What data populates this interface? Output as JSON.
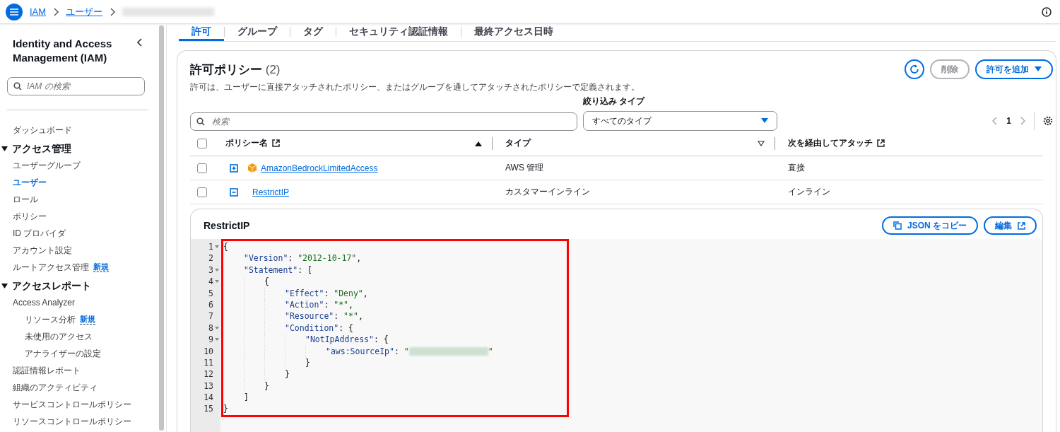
{
  "breadcrumbs": [
    {
      "label": "IAM",
      "kind": "link"
    },
    {
      "label": "ユーザー",
      "kind": "link"
    },
    {
      "kind": "redacted"
    }
  ],
  "sidebar": {
    "title": "Identity and Access Management (IAM)",
    "search": {
      "placeholder": "IAM の検索"
    },
    "items": [
      {
        "label": "ダッシュボード",
        "kind": "link",
        "selected": false
      },
      {
        "label": "アクセス管理",
        "kind": "section",
        "expanded": true,
        "children": [
          {
            "label": "ユーザーグループ",
            "selected": false
          },
          {
            "label": "ユーザー",
            "selected": true
          },
          {
            "label": "ロール",
            "selected": false
          },
          {
            "label": "ポリシー",
            "selected": false
          },
          {
            "label": "ID プロバイダ",
            "selected": false
          },
          {
            "label": "アカウント設定",
            "selected": false
          },
          {
            "label": "ルートアクセス管理",
            "selected": false,
            "badge": "新規"
          }
        ]
      },
      {
        "label": "アクセスレポート",
        "kind": "section",
        "expanded": true,
        "children": [
          {
            "label": "Access Analyzer",
            "selected": false,
            "children": [
              {
                "label": "リソース分析",
                "selected": false,
                "badge": "新規"
              },
              {
                "label": "未使用のアクセス",
                "selected": false
              },
              {
                "label": "アナライザーの設定",
                "selected": false
              }
            ]
          },
          {
            "label": "認証情報レポート",
            "selected": false
          },
          {
            "label": "組織のアクティビティ",
            "selected": false
          },
          {
            "label": "サービスコントロールポリシー",
            "selected": false
          },
          {
            "label": "リソースコントロールポリシー",
            "selected": false
          }
        ]
      }
    ]
  },
  "tabs": [
    {
      "label": "許可",
      "selected": true
    },
    {
      "label": "グループ",
      "selected": false
    },
    {
      "label": "タグ",
      "selected": false
    },
    {
      "label": "セキュリティ認証情報",
      "selected": false
    },
    {
      "label": "最終アクセス日時",
      "selected": false
    }
  ],
  "policies": {
    "title": "許可ポリシー",
    "count": "(2)",
    "description": "許可は、ユーザーに直接アタッチされたポリシー、またはグループを通してアタッチされたポリシーで定義されます。",
    "buttons": [
      {
        "label": "削除",
        "disabled": true
      },
      {
        "label": "許可を追加",
        "disabled": false
      }
    ],
    "search": {
      "placeholder": "検索"
    },
    "filter": {
      "label": "絞り込み タイプ",
      "value": "すべてのタイプ"
    },
    "page": "1",
    "select_all": {
      "checked": false
    },
    "columns": [
      {
        "label": "ポリシー名",
        "sortable": true,
        "sorted": true,
        "external": true
      },
      {
        "label": "タイプ",
        "sortable": true,
        "sorted": false,
        "external": false
      },
      {
        "label": "次を経由してアタッチ",
        "sortable": false,
        "external": true
      }
    ],
    "rows": [
      {
        "name": "AmazonBedrockLimitedAccess",
        "managed": true,
        "expanded": false,
        "checked": false,
        "type": "AWS 管理",
        "attached": "直接"
      },
      {
        "name": "RestrictIP",
        "managed": false,
        "expanded": true,
        "checked": false,
        "type": "カスタマーインライン",
        "attached": "インライン"
      }
    ]
  },
  "detail": {
    "title": "RestrictIP",
    "buttons": [
      {
        "label": "JSON をコピー",
        "kind": "copy"
      },
      {
        "label": "編集",
        "kind": "external"
      }
    ],
    "highlighted": true,
    "code": [
      {
        "n": "1",
        "fold": true,
        "tokens": [
          {
            "kind": "punct",
            "text": "{"
          }
        ]
      },
      {
        "n": "2",
        "fold": false,
        "tokens": [
          {
            "kind": "key",
            "text": "\"Version\""
          },
          {
            "kind": "punct",
            "text": ": "
          },
          {
            "kind": "string",
            "text": "\"2012-10-17\""
          },
          {
            "kind": "punct",
            "text": ","
          }
        ]
      },
      {
        "n": "3",
        "fold": true,
        "tokens": [
          {
            "kind": "key",
            "text": "\"Statement\""
          },
          {
            "kind": "punct",
            "text": ": ["
          }
        ]
      },
      {
        "n": "4",
        "fold": true,
        "tokens": [
          {
            "kind": "punct",
            "text": "{"
          }
        ]
      },
      {
        "n": "5",
        "fold": false,
        "tokens": [
          {
            "kind": "key",
            "text": "\"Effect\""
          },
          {
            "kind": "punct",
            "text": ": "
          },
          {
            "kind": "string",
            "text": "\"Deny\""
          },
          {
            "kind": "punct",
            "text": ","
          }
        ]
      },
      {
        "n": "6",
        "fold": false,
        "tokens": [
          {
            "kind": "key",
            "text": "\"Action\""
          },
          {
            "kind": "punct",
            "text": ": "
          },
          {
            "kind": "string",
            "text": "\"*\""
          },
          {
            "kind": "punct",
            "text": ","
          }
        ]
      },
      {
        "n": "7",
        "fold": false,
        "tokens": [
          {
            "kind": "key",
            "text": "\"Resource\""
          },
          {
            "kind": "punct",
            "text": ": "
          },
          {
            "kind": "string",
            "text": "\"*\""
          },
          {
            "kind": "punct",
            "text": ","
          }
        ]
      },
      {
        "n": "8",
        "fold": true,
        "tokens": [
          {
            "kind": "key",
            "text": "\"Condition\""
          },
          {
            "kind": "punct",
            "text": ": {"
          }
        ]
      },
      {
        "n": "9",
        "fold": true,
        "tokens": [
          {
            "kind": "key",
            "text": "\"NotIpAddress\""
          },
          {
            "kind": "punct",
            "text": ": {"
          }
        ]
      },
      {
        "n": "10",
        "fold": false,
        "tokens": [
          {
            "kind": "key",
            "text": "\"aws:SourceIp\""
          },
          {
            "kind": "punct",
            "text": ": "
          },
          {
            "kind": "string",
            "text": "\""
          },
          {
            "kind": "redacted"
          },
          {
            "kind": "string",
            "text": "\""
          }
        ]
      },
      {
        "n": "11",
        "fold": false,
        "tokens": [
          {
            "kind": "punct",
            "text": "}"
          }
        ]
      },
      {
        "n": "12",
        "fold": false,
        "tokens": [
          {
            "kind": "punct",
            "text": "}"
          }
        ]
      },
      {
        "n": "13",
        "fold": false,
        "tokens": [
          {
            "kind": "punct",
            "text": "}"
          }
        ]
      },
      {
        "n": "14",
        "fold": false,
        "tokens": [
          {
            "kind": "punct",
            "text": "]"
          }
        ]
      },
      {
        "n": "15",
        "fold": false,
        "tokens": [
          {
            "kind": "punct",
            "text": "}"
          }
        ]
      }
    ]
  }
}
